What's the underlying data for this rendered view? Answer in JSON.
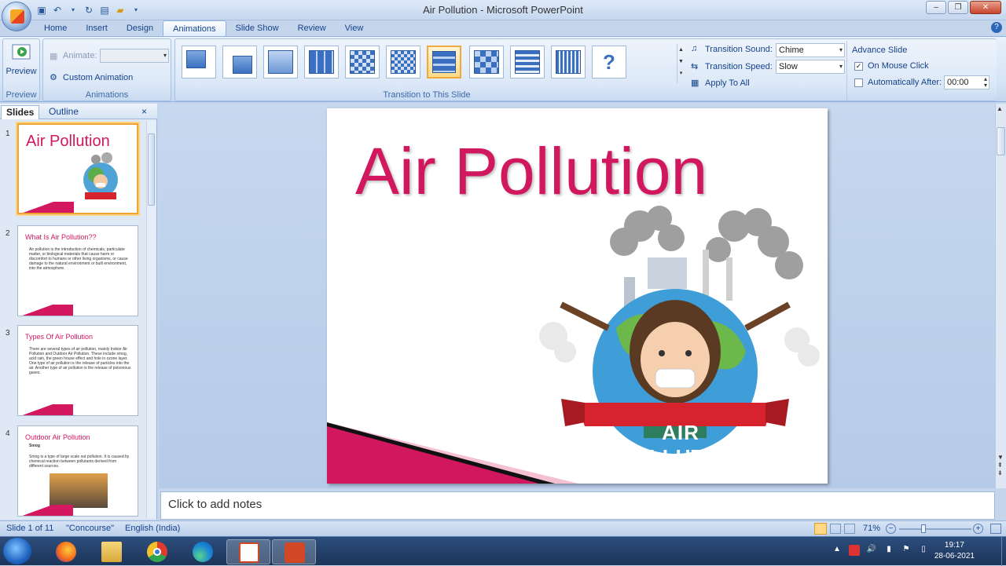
{
  "app": {
    "title": "Air Pollution - Microsoft PowerPoint"
  },
  "ribbon_tabs": [
    "Home",
    "Insert",
    "Design",
    "Animations",
    "Slide Show",
    "Review",
    "View"
  ],
  "active_tab": "Animations",
  "ribbon": {
    "preview_label": "Preview",
    "preview_group": "Preview",
    "animate_label": "Animate:",
    "custom_animation_label": "Custom Animation",
    "animations_group": "Animations",
    "transition_group": "Transition to This Slide",
    "transition_sound_label": "Transition Sound:",
    "transition_sound_value": "Chime",
    "transition_speed_label": "Transition Speed:",
    "transition_speed_value": "Slow",
    "apply_all_label": "Apply To All",
    "advance_slide_label": "Advance Slide",
    "on_mouse_click_label": "On Mouse Click",
    "on_mouse_click_checked": true,
    "auto_after_label": "Automatically After:",
    "auto_after_value": "00:00",
    "auto_after_checked": false
  },
  "panel_tabs": {
    "slides": "Slides",
    "outline": "Outline",
    "close": "×"
  },
  "slides": [
    {
      "num": "1",
      "title": "Air Pollution"
    },
    {
      "num": "2",
      "title": "What Is Air Pollution??",
      "body": "Air pollution is the introduction of chemicals, particulate matter, or biological materials that cause harm or discomfort to humans or other living organisms, or cause damage to the natural environment or built environment, into the atmosphere."
    },
    {
      "num": "3",
      "title": "Types Of Air Pollution",
      "body": "There are several types of air pollution, mainly Indoor Air Pollution and Outdoor Air Pollution. These include smog, acid rain, the green house effect and hole in ozone layer. One type of air pollution is the release of particles into the air. Another type of air pollution is the release of poisonous gases."
    },
    {
      "num": "4",
      "title": "Outdoor Air Pollution",
      "subtitle": "Smog",
      "body": "Smog is a type of large scale out pollution. It is caused by chemical reaction between pollutants derived from different sources."
    }
  ],
  "current_slide": {
    "title": "Air Pollution",
    "banner": "AIR POLLUTION"
  },
  "notes_placeholder": "Click to add notes",
  "status": {
    "slide_info": "Slide 1 of 11",
    "theme": "\"Concourse\"",
    "language": "English (India)",
    "zoom": "71%"
  },
  "taskbar": {
    "time": "19:17",
    "date": "28-06-2021"
  },
  "colors": {
    "accent": "#d1175e",
    "ribbon": "#dbe7f6",
    "taskbar": "#1c3458"
  }
}
